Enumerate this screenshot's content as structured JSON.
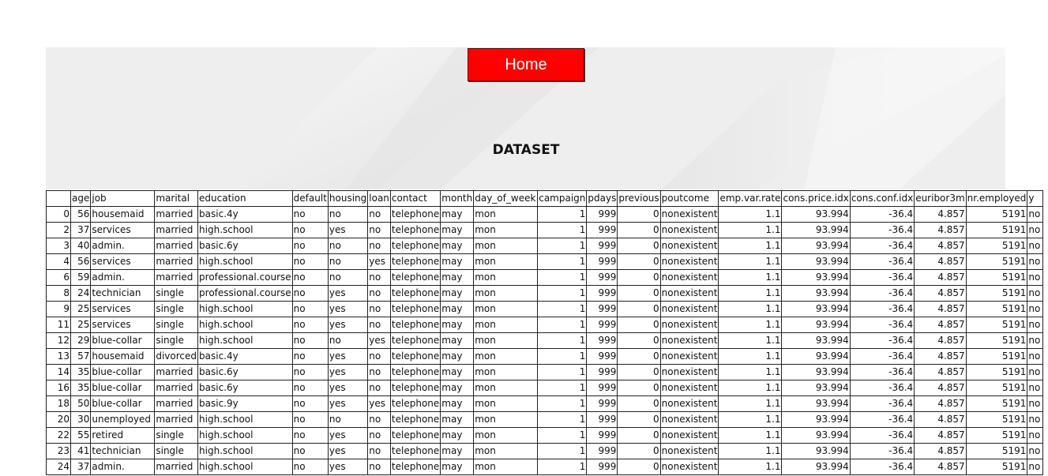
{
  "nav": {
    "home_label": "Home"
  },
  "page": {
    "title": "DATASET"
  },
  "colors": {
    "home_button": "#ff0000",
    "banner": "#eeeeee"
  },
  "table": {
    "columns": [
      "",
      "age",
      "job",
      "marital",
      "education",
      "default",
      "housing",
      "loan",
      "contact",
      "month",
      "day_of_week",
      "campaign",
      "pdays",
      "previous",
      "poutcome",
      "emp.var.rate",
      "cons.price.idx",
      "cons.conf.idx",
      "euribor3m",
      "nr.employed",
      "y"
    ],
    "rows": [
      [
        "0",
        "56",
        "housemaid",
        "married",
        "basic.4y",
        "no",
        "no",
        "no",
        "telephone",
        "may",
        "mon",
        "1",
        "999",
        "0",
        "nonexistent",
        "1.1",
        "93.994",
        "-36.4",
        "4.857",
        "5191",
        "no"
      ],
      [
        "2",
        "37",
        "services",
        "married",
        "high.school",
        "no",
        "yes",
        "no",
        "telephone",
        "may",
        "mon",
        "1",
        "999",
        "0",
        "nonexistent",
        "1.1",
        "93.994",
        "-36.4",
        "4.857",
        "5191",
        "no"
      ],
      [
        "3",
        "40",
        "admin.",
        "married",
        "basic.6y",
        "no",
        "no",
        "no",
        "telephone",
        "may",
        "mon",
        "1",
        "999",
        "0",
        "nonexistent",
        "1.1",
        "93.994",
        "-36.4",
        "4.857",
        "5191",
        "no"
      ],
      [
        "4",
        "56",
        "services",
        "married",
        "high.school",
        "no",
        "no",
        "yes",
        "telephone",
        "may",
        "mon",
        "1",
        "999",
        "0",
        "nonexistent",
        "1.1",
        "93.994",
        "-36.4",
        "4.857",
        "5191",
        "no"
      ],
      [
        "6",
        "59",
        "admin.",
        "married",
        "professional.course",
        "no",
        "no",
        "no",
        "telephone",
        "may",
        "mon",
        "1",
        "999",
        "0",
        "nonexistent",
        "1.1",
        "93.994",
        "-36.4",
        "4.857",
        "5191",
        "no"
      ],
      [
        "8",
        "24",
        "technician",
        "single",
        "professional.course",
        "no",
        "yes",
        "no",
        "telephone",
        "may",
        "mon",
        "1",
        "999",
        "0",
        "nonexistent",
        "1.1",
        "93.994",
        "-36.4",
        "4.857",
        "5191",
        "no"
      ],
      [
        "9",
        "25",
        "services",
        "single",
        "high.school",
        "no",
        "yes",
        "no",
        "telephone",
        "may",
        "mon",
        "1",
        "999",
        "0",
        "nonexistent",
        "1.1",
        "93.994",
        "-36.4",
        "4.857",
        "5191",
        "no"
      ],
      [
        "11",
        "25",
        "services",
        "single",
        "high.school",
        "no",
        "yes",
        "no",
        "telephone",
        "may",
        "mon",
        "1",
        "999",
        "0",
        "nonexistent",
        "1.1",
        "93.994",
        "-36.4",
        "4.857",
        "5191",
        "no"
      ],
      [
        "12",
        "29",
        "blue-collar",
        "single",
        "high.school",
        "no",
        "no",
        "yes",
        "telephone",
        "may",
        "mon",
        "1",
        "999",
        "0",
        "nonexistent",
        "1.1",
        "93.994",
        "-36.4",
        "4.857",
        "5191",
        "no"
      ],
      [
        "13",
        "57",
        "housemaid",
        "divorced",
        "basic.4y",
        "no",
        "yes",
        "no",
        "telephone",
        "may",
        "mon",
        "1",
        "999",
        "0",
        "nonexistent",
        "1.1",
        "93.994",
        "-36.4",
        "4.857",
        "5191",
        "no"
      ],
      [
        "14",
        "35",
        "blue-collar",
        "married",
        "basic.6y",
        "no",
        "yes",
        "no",
        "telephone",
        "may",
        "mon",
        "1",
        "999",
        "0",
        "nonexistent",
        "1.1",
        "93.994",
        "-36.4",
        "4.857",
        "5191",
        "no"
      ],
      [
        "16",
        "35",
        "blue-collar",
        "married",
        "basic.6y",
        "no",
        "yes",
        "no",
        "telephone",
        "may",
        "mon",
        "1",
        "999",
        "0",
        "nonexistent",
        "1.1",
        "93.994",
        "-36.4",
        "4.857",
        "5191",
        "no"
      ],
      [
        "18",
        "50",
        "blue-collar",
        "married",
        "basic.9y",
        "no",
        "yes",
        "yes",
        "telephone",
        "may",
        "mon",
        "1",
        "999",
        "0",
        "nonexistent",
        "1.1",
        "93.994",
        "-36.4",
        "4.857",
        "5191",
        "no"
      ],
      [
        "20",
        "30",
        "unemployed",
        "married",
        "high.school",
        "no",
        "no",
        "no",
        "telephone",
        "may",
        "mon",
        "1",
        "999",
        "0",
        "nonexistent",
        "1.1",
        "93.994",
        "-36.4",
        "4.857",
        "5191",
        "no"
      ],
      [
        "22",
        "55",
        "retired",
        "single",
        "high.school",
        "no",
        "yes",
        "no",
        "telephone",
        "may",
        "mon",
        "1",
        "999",
        "0",
        "nonexistent",
        "1.1",
        "93.994",
        "-36.4",
        "4.857",
        "5191",
        "no"
      ],
      [
        "23",
        "41",
        "technician",
        "single",
        "high.school",
        "no",
        "yes",
        "no",
        "telephone",
        "may",
        "mon",
        "1",
        "999",
        "0",
        "nonexistent",
        "1.1",
        "93.994",
        "-36.4",
        "4.857",
        "5191",
        "no"
      ],
      [
        "24",
        "37",
        "admin.",
        "married",
        "high.school",
        "no",
        "yes",
        "no",
        "telephone",
        "may",
        "mon",
        "1",
        "999",
        "0",
        "nonexistent",
        "1.1",
        "93.994",
        "-36.4",
        "4.857",
        "5191",
        "no"
      ]
    ]
  }
}
